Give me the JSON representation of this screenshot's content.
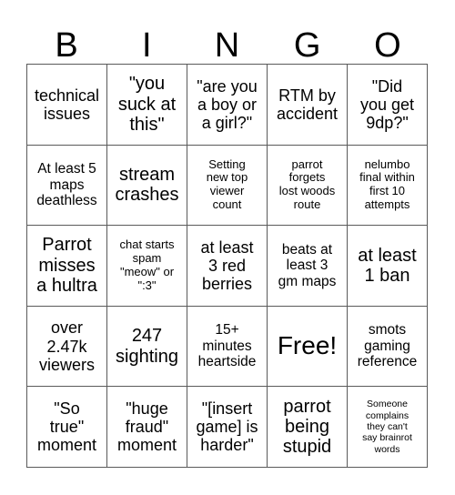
{
  "header": {
    "letters": [
      "B",
      "I",
      "N",
      "G",
      "O"
    ]
  },
  "grid": {
    "rows": 5,
    "columns": 5,
    "border_color": "#5a5a5a",
    "background_color": "#ffffff",
    "text_color": "#000000",
    "cells": [
      {
        "text": "technical\nissues",
        "size": "fs-lg"
      },
      {
        "text": "\"you\nsuck at\nthis\"",
        "size": "fs-xl"
      },
      {
        "text": "\"are you\na boy or\na girl?\"",
        "size": "fs-lg"
      },
      {
        "text": "RTM by\naccident",
        "size": "fs-lg"
      },
      {
        "text": "\"Did\nyou get\n9dp?\"",
        "size": "fs-lg"
      },
      {
        "text": "At least 5\nmaps\ndeathless",
        "size": "fs-md"
      },
      {
        "text": "stream\ncrashes",
        "size": "fs-xl"
      },
      {
        "text": "Setting\nnew top\nviewer\ncount",
        "size": "fs-sm"
      },
      {
        "text": "parrot\nforgets\nlost woods\nroute",
        "size": "fs-sm"
      },
      {
        "text": "nelumbo\nfinal within\nfirst 10\nattempts",
        "size": "fs-sm"
      },
      {
        "text": "Parrot\nmisses\na hultra",
        "size": "fs-xl"
      },
      {
        "text": "chat starts\nspam\n\"meow\" or\n\":3\"",
        "size": "fs-sm"
      },
      {
        "text": "at least\n3 red\nberries",
        "size": "fs-lg"
      },
      {
        "text": "beats at\nleast 3\ngm maps",
        "size": "fs-md"
      },
      {
        "text": "at least\n1 ban",
        "size": "fs-xl"
      },
      {
        "text": "over\n2.47k\nviewers",
        "size": "fs-lg"
      },
      {
        "text": "247\nsighting",
        "size": "fs-xl"
      },
      {
        "text": "15+\nminutes\nheartside",
        "size": "fs-md"
      },
      {
        "text": "Free!",
        "size": "fs-free"
      },
      {
        "text": "smots\ngaming\nreference",
        "size": "fs-md"
      },
      {
        "text": "\"So\ntrue\"\nmoment",
        "size": "fs-lg"
      },
      {
        "text": "\"huge\nfraud\"\nmoment",
        "size": "fs-lg"
      },
      {
        "text": "\"[insert\ngame] is\nharder\"",
        "size": "fs-lg"
      },
      {
        "text": "parrot\nbeing\nstupid",
        "size": "fs-xl"
      },
      {
        "text": "Someone\ncomplains\nthey can't\nsay brainrot\nwords",
        "size": "fs-xs"
      }
    ]
  }
}
